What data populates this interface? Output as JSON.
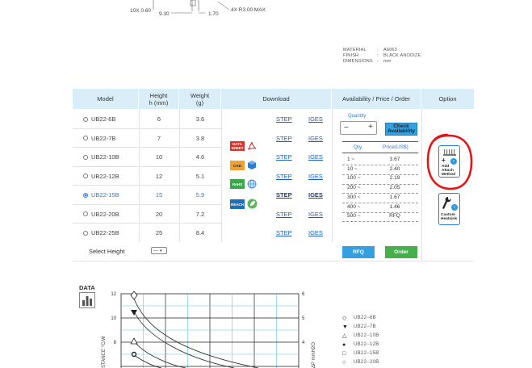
{
  "drawing": {
    "dim_left": "10X 0.60",
    "dim_mid": "9.30",
    "dim_170": "1.70",
    "dim_r": "4X R3.00 MAX"
  },
  "spec": {
    "material_label": "MATERIAL",
    "material_value": "A6063",
    "finish_label": "FINISH",
    "finish_value": "BLACK ANODIZE",
    "dimensions_label": "DIMENSIONS",
    "dimensions_value": "mm",
    "colon": ":"
  },
  "table": {
    "headers": {
      "model": "Model",
      "height": "Height\nh (mm)",
      "weight": "Weight\n(g)",
      "download": "Download",
      "availability": "Availability / Price / Order",
      "option": "Option"
    },
    "rows": [
      {
        "model": "UB22-6B",
        "height": "6",
        "weight": "3.6",
        "step": "STEP",
        "iges": "IGES",
        "selected": false
      },
      {
        "model": "UB22-7B",
        "height": "7",
        "weight": "3.8",
        "step": "STEP",
        "iges": "IGES",
        "selected": false
      },
      {
        "model": "UB22-10B",
        "height": "10",
        "weight": "4.6",
        "step": "STEP",
        "iges": "IGES",
        "selected": false
      },
      {
        "model": "UB22-12B",
        "height": "12",
        "weight": "5.1",
        "step": "STEP",
        "iges": "IGES",
        "selected": false
      },
      {
        "model": "UB22-15B",
        "height": "15",
        "weight": "5.9",
        "step": "STEP",
        "iges": "IGES",
        "selected": true
      },
      {
        "model": "UB22-20B",
        "height": "20",
        "weight": "7.2",
        "step": "STEP",
        "iges": "IGES",
        "selected": false
      },
      {
        "model": "UB22-25B",
        "height": "25",
        "weight": "8.4",
        "step": "STEP",
        "iges": "IGES",
        "selected": false
      }
    ],
    "select_height_label": "Select Height",
    "select_height_value": "---"
  },
  "download_tags": {
    "datasheet": "DATA\nSHEET",
    "cad": "CAD",
    "rohs": "RoHS",
    "reach": "REACH"
  },
  "order": {
    "quantity_label": "Quantity",
    "minus": "−",
    "plus": "+",
    "check_availability": "Check\nAvailability",
    "qty_header": "Qty.",
    "price_header": "Price(US$)",
    "prices": [
      {
        "qty": "1 ~",
        "price": "3.67"
      },
      {
        "qty": "10 ~",
        "price": "2.40"
      },
      {
        "qty": "100 ~",
        "price": "2.19"
      },
      {
        "qty": "200 ~",
        "price": "2.05"
      },
      {
        "qty": "300 ~",
        "price": "1.67"
      },
      {
        "qty": "400 ~",
        "price": "1.46"
      },
      {
        "qty": "500 ~",
        "price": "RFQ"
      }
    ],
    "rfq_button": "RFQ",
    "order_button": "Order"
  },
  "options": {
    "add_attach": "Add\nAttach\nMethod",
    "custom_heatsink": "Custom\nHeatsink"
  },
  "graph": {
    "data_icon_label": "DATA",
    "left_ticks": [
      "12",
      "10",
      "8"
    ],
    "right_ticks": [
      "6",
      "5",
      "4"
    ],
    "left_axis_label": "STANCE  °C/W",
    "right_axis_label": "ΔP  mmH2O",
    "legend": [
      {
        "symbol": "◇",
        "label": "UB22−6B"
      },
      {
        "symbol": "▼",
        "label": "UB22−7B"
      },
      {
        "symbol": "△",
        "label": "UB22−10B"
      },
      {
        "symbol": "●",
        "label": "UB22−12B"
      },
      {
        "symbol": "□",
        "label": "UB22−15B"
      },
      {
        "symbol": "○",
        "label": "UB22−20B"
      }
    ]
  },
  "colors": {
    "header_bg": "#daeef9",
    "link": "#1a5fb4",
    "selected": "#2a7bd3",
    "rfq_button": "#34a0e0",
    "order_button": "#45b04a",
    "annotation_circle": "#e01818",
    "grid": "#5cc8d8"
  }
}
